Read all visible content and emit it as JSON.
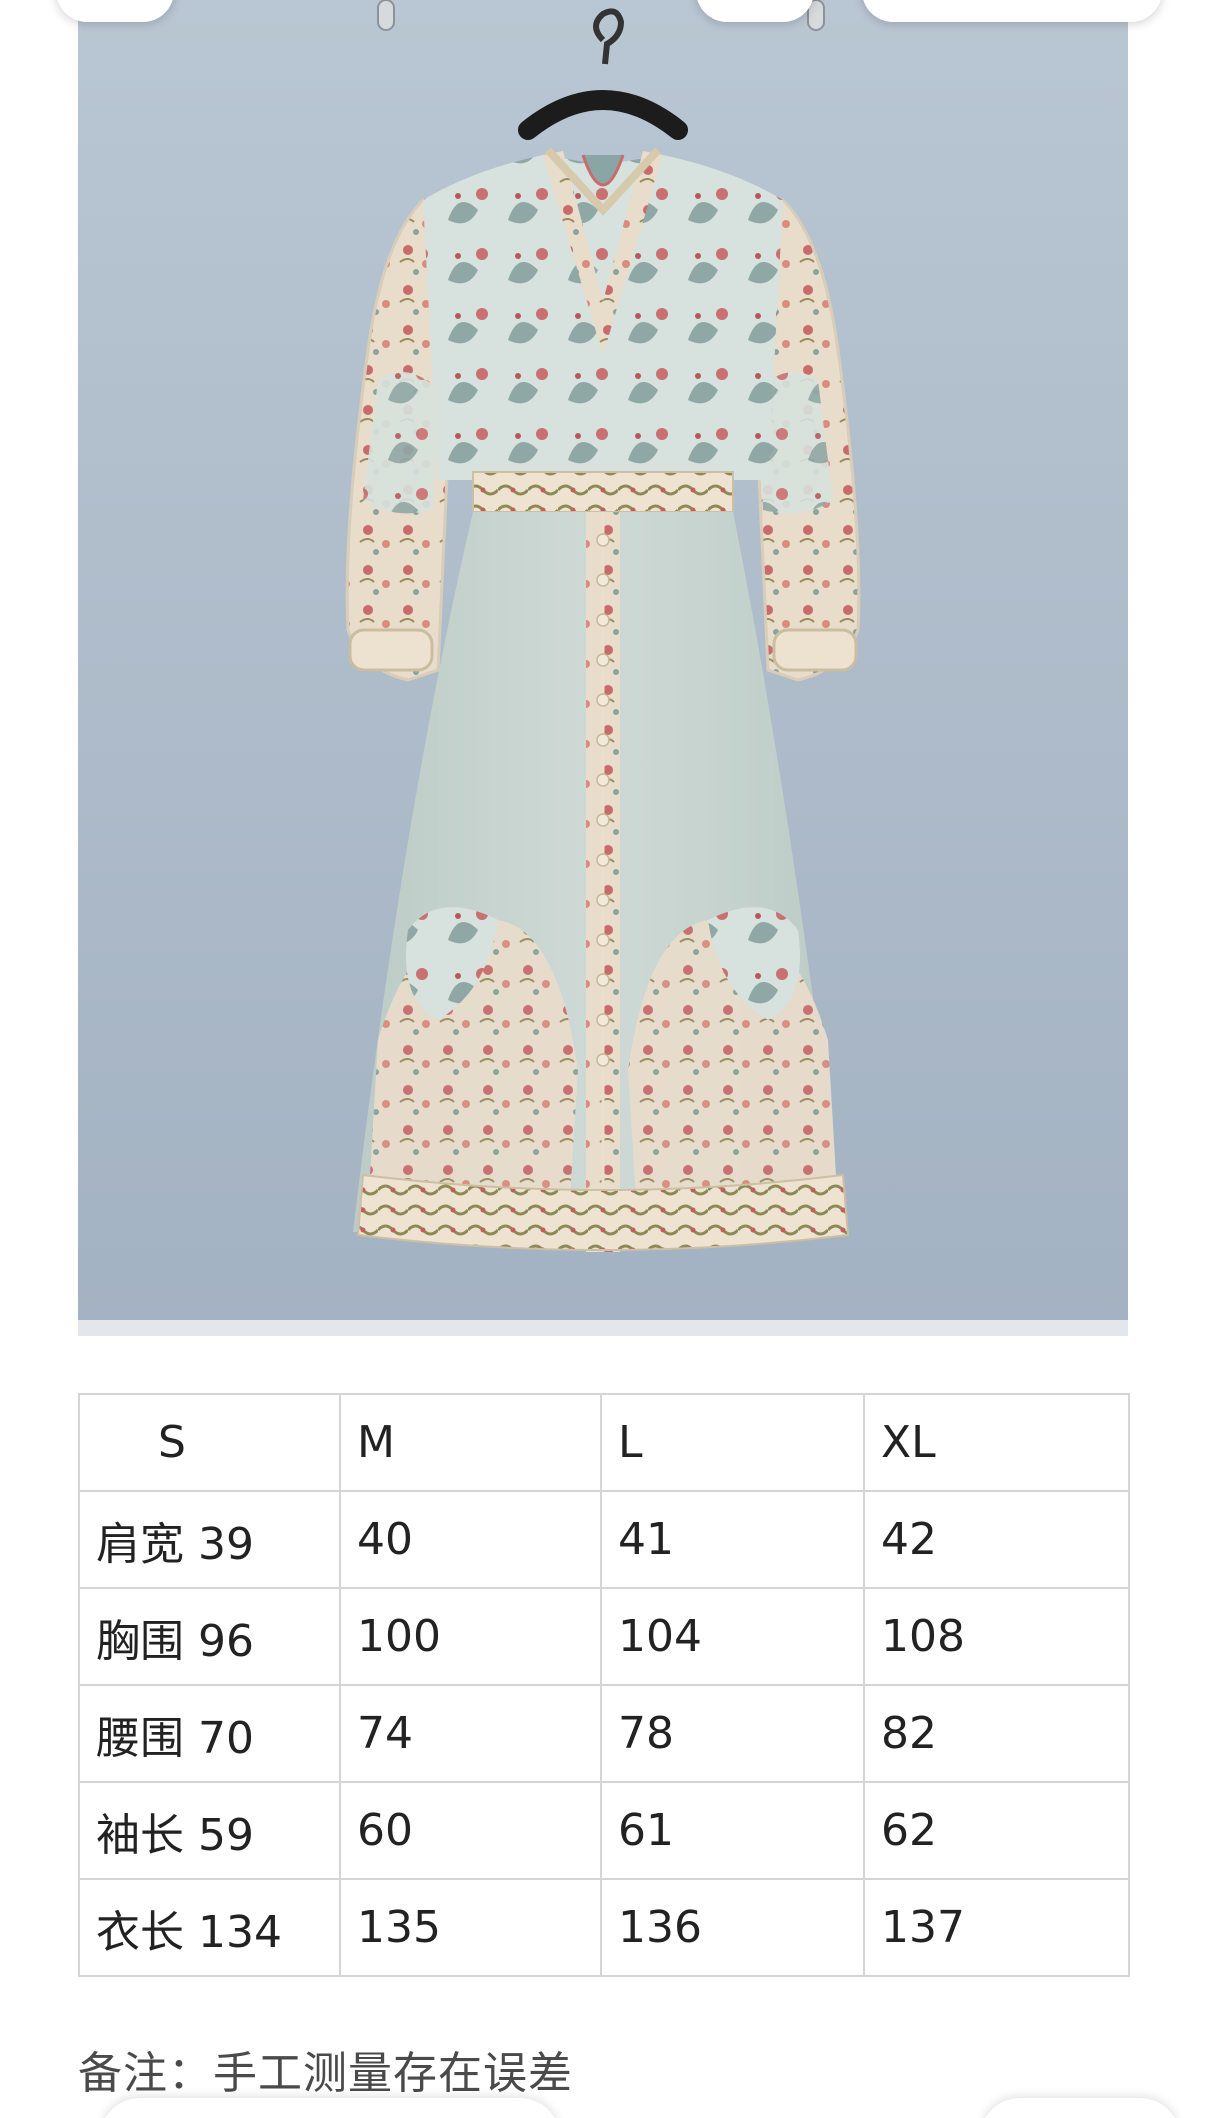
{
  "size_table": {
    "header": [
      "S",
      "M",
      "L",
      "XL"
    ],
    "rows": [
      [
        "肩宽 39",
        "40",
        "41",
        "42"
      ],
      [
        "胸围 96",
        "100",
        "104",
        "108"
      ],
      [
        "腰围 70",
        "74",
        "78",
        "82"
      ],
      [
        "袖长 59",
        "60",
        "61",
        "62"
      ],
      [
        "衣长 134",
        "135",
        "136",
        "137"
      ]
    ]
  },
  "note": "备注：手工测量存在误差",
  "colors": {
    "wall": "#aab8c7",
    "dress_base": "#c9d6d2",
    "print_red": "#c86a6a",
    "print_cream": "#efe6d6",
    "table_border": "#d5d5d5"
  }
}
